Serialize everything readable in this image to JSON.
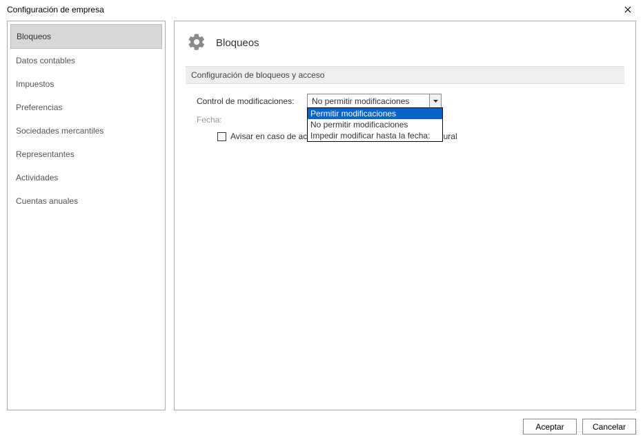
{
  "window": {
    "title": "Configuración de empresa"
  },
  "sidebar": {
    "items": [
      {
        "label": "Bloqueos",
        "active": true
      },
      {
        "label": "Datos contables",
        "active": false
      },
      {
        "label": "Impuestos",
        "active": false
      },
      {
        "label": "Preferencias",
        "active": false
      },
      {
        "label": "Sociedades mercantiles",
        "active": false
      },
      {
        "label": "Representantes",
        "active": false
      },
      {
        "label": "Actividades",
        "active": false
      },
      {
        "label": "Cuentas anuales",
        "active": false
      }
    ]
  },
  "main": {
    "title": "Bloqueos",
    "section_header": "Configuración de bloqueos y acceso",
    "control_label": "Control de modificaciones:",
    "control_value": "No permitir modificaciones",
    "control_options": [
      "Permitir modificaciones",
      "No permitir modificaciones",
      "Impedir modificar hasta la fecha:"
    ],
    "highlighted_option_index": 0,
    "fecha_label": "Fecha:",
    "avisar_label": "Avisar en caso de acceder a un ejercicio fuera del año natural"
  },
  "buttons": {
    "accept": "Aceptar",
    "cancel": "Cancelar"
  }
}
